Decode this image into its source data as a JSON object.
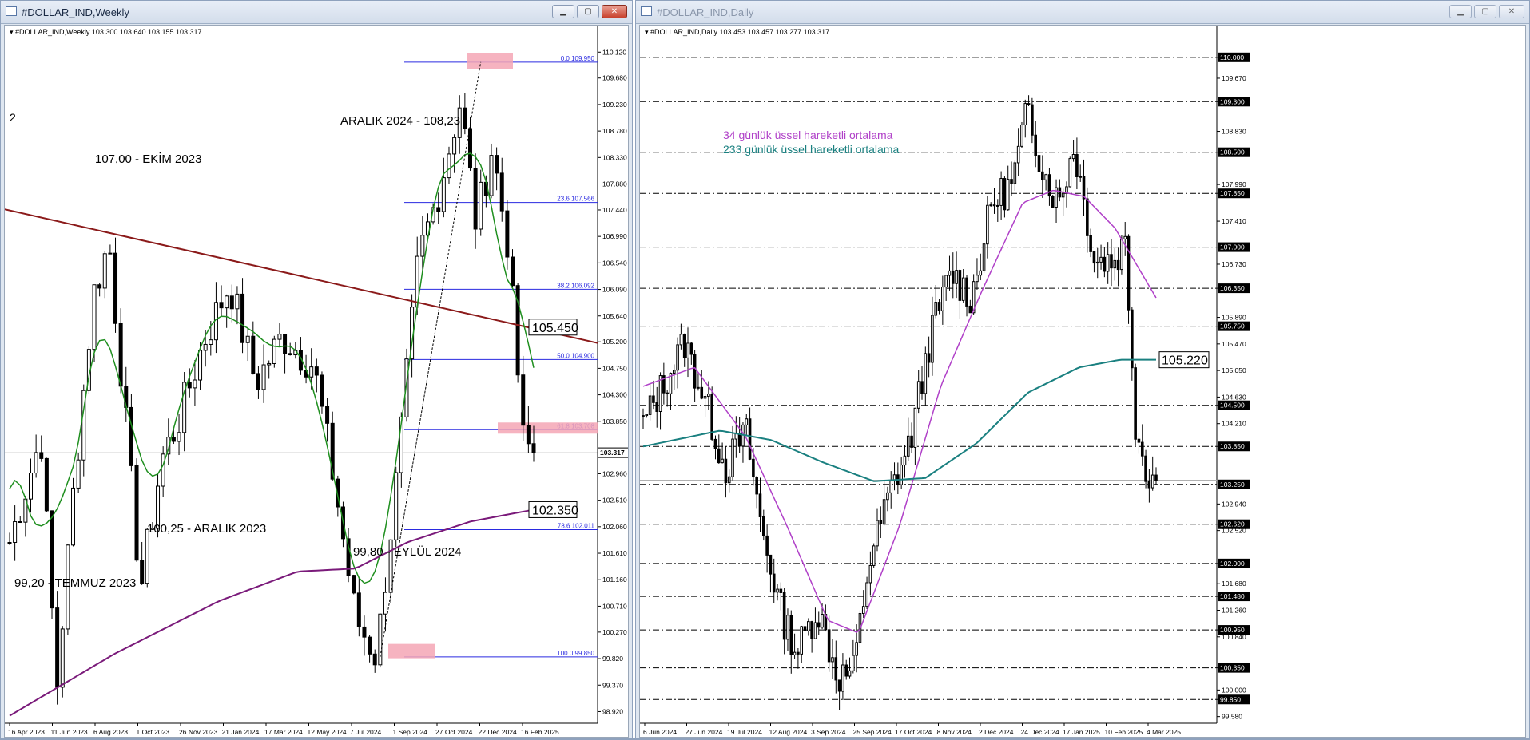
{
  "left_window": {
    "title": "#DOLLAR_IND,Weekly",
    "info": "#DOLLAR_IND,Weekly  103.300 103.640 103.155 103.317",
    "side_label": "2",
    "price_labels": [
      "110.120",
      "109.680",
      "109.230",
      "108.780",
      "108.330",
      "107.880",
      "107.440",
      "106.990",
      "106.540",
      "106.090",
      "105.640",
      "105.200",
      "104.750",
      "104.300",
      "103.850",
      "102.960",
      "102.510",
      "102.060",
      "101.610",
      "101.160",
      "100.710",
      "100.270",
      "99.820",
      "99.370",
      "98.920"
    ],
    "current_price": "103.317",
    "date_labels": [
      "16 Apr 2023",
      "11 Jun 2023",
      "6 Aug 2023",
      "1 Oct 2023",
      "26 Nov 2023",
      "21 Jan 2024",
      "17 Mar 2024",
      "12 May 2024",
      "7 Jul 2024",
      "1 Sep 2024",
      "27 Oct 2024",
      "22 Dec 2024",
      "16 Feb 2025"
    ],
    "fib_levels": [
      {
        "label": "0.0 109.950",
        "price": 109.95
      },
      {
        "label": "23.6 107.566",
        "price": 107.566
      },
      {
        "label": "38.2 106.092",
        "price": 106.092
      },
      {
        "label": "50.0 104.900",
        "price": 104.9
      },
      {
        "label": "61.8 103.708",
        "price": 103.708
      },
      {
        "label": "78.6 102.011",
        "price": 102.011
      },
      {
        "label": "100.0 99.850",
        "price": 99.85
      }
    ],
    "annotations": {
      "aralik_2024": "ARALIK 2024 - 108,23",
      "ekim_2023": "107,00 - EKİM 2023",
      "aralik_2023": "100,25 - ARALIK 2023",
      "eylul_2024": "99,80 - EYLÜL 2024",
      "temmuz_2023": "99,20 - TEMMUZ 2023"
    },
    "boxed_labels": {
      "trendline_level": "105.450",
      "ema_level": "102.350"
    },
    "colors": {
      "trendline": "#8b1a1a",
      "green_ma": "#1f8f1f",
      "purple_ma": "#7a1a7a",
      "fib": "#2a2ae0",
      "zone": "#f4a6b5"
    }
  },
  "right_window": {
    "title": "#DOLLAR_IND,Daily",
    "info": "#DOLLAR_IND,Daily  103.453 103.457 103.277 103.317",
    "price_labels": [
      "110.000",
      "109.670",
      "109.300",
      "108.830",
      "108.500",
      "107.990",
      "107.850",
      "107.410",
      "107.000",
      "106.730",
      "106.350",
      "105.890",
      "105.750",
      "105.470",
      "105.050",
      "104.630",
      "104.500",
      "104.210",
      "103.850",
      "102.940",
      "102.620",
      "102.520",
      "102.000",
      "101.680",
      "101.480",
      "101.260",
      "100.950",
      "100.840",
      "100.350",
      "100.000",
      "99.850",
      "99.580"
    ],
    "highlighted_levels": [
      "110.000",
      "109.300",
      "108.500",
      "107.850",
      "107.000",
      "106.350",
      "105.750",
      "104.500",
      "103.850",
      "103.250",
      "102.620",
      "102.000",
      "101.480",
      "100.950",
      "100.350",
      "99.850"
    ],
    "current_price": "103.250",
    "date_labels": [
      "6 Jun 2024",
      "27 Jun 2024",
      "19 Jul 2024",
      "12 Aug 2024",
      "3 Sep 2024",
      "25 Sep 2024",
      "17 Oct 2024",
      "8 Nov 2024",
      "2 Dec 2024",
      "24 Dec 2024",
      "17 Jan 2025",
      "10 Feb 2025",
      "4 Mar 2025"
    ],
    "legend": {
      "ema34": "34 günlük üssel hareketli ortalama",
      "ema233": "233 günlük üssel hareketli ortalama"
    },
    "boxed_label": "105.220",
    "colors": {
      "ema34": "#b040c8",
      "ema233": "#1a8080"
    }
  }
}
